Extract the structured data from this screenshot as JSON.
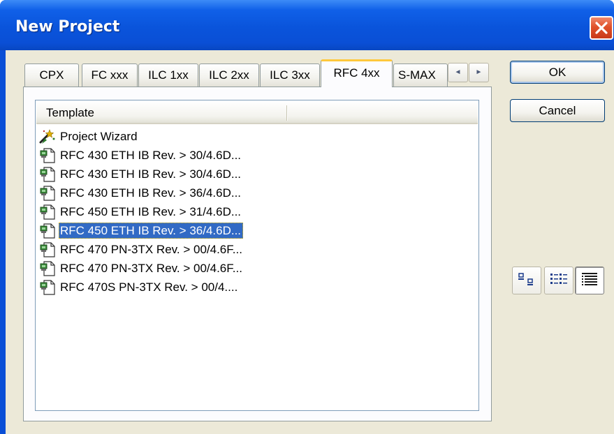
{
  "window": {
    "title": "New Project"
  },
  "tabs": [
    {
      "label": "CPX",
      "active": false
    },
    {
      "label": "FC xxx",
      "active": false
    },
    {
      "label": "ILC 1xx",
      "active": false
    },
    {
      "label": "ILC 2xx",
      "active": false
    },
    {
      "label": "ILC 3xx",
      "active": false
    },
    {
      "label": "RFC 4xx",
      "active": true
    },
    {
      "label": "S-MAX",
      "active": false
    }
  ],
  "tab_scroll": {
    "left": "◄",
    "right": "►"
  },
  "list": {
    "column_header": "Template",
    "items": [
      {
        "label": "Project Wizard",
        "icon": "wizard-icon",
        "selected": false
      },
      {
        "label": "RFC 430 ETH IB Rev. > 30/4.6D...",
        "icon": "template-file-icon",
        "selected": false
      },
      {
        "label": "RFC 430 ETH IB Rev. > 30/4.6D...",
        "icon": "template-file-icon",
        "selected": false
      },
      {
        "label": "RFC 430 ETH IB Rev. > 36/4.6D...",
        "icon": "template-file-icon",
        "selected": false
      },
      {
        "label": "RFC 450 ETH IB Rev. > 31/4.6D...",
        "icon": "template-file-icon",
        "selected": false
      },
      {
        "label": "RFC 450 ETH IB Rev. > 36/4.6D...",
        "icon": "template-file-icon",
        "selected": true
      },
      {
        "label": "RFC 470 PN-3TX Rev. > 00/4.6F...",
        "icon": "template-file-icon",
        "selected": false
      },
      {
        "label": "RFC 470 PN-3TX Rev. > 00/4.6F...",
        "icon": "template-file-icon",
        "selected": false
      },
      {
        "label": "RFC 470S PN-3TX Rev. > 00/4....",
        "icon": "template-file-icon",
        "selected": false
      }
    ]
  },
  "buttons": {
    "ok": "OK",
    "cancel": "Cancel"
  },
  "view_buttons": [
    {
      "name": "large-icons",
      "icon": "large-icons-view-icon",
      "pressed": false
    },
    {
      "name": "list",
      "icon": "list-view-icon",
      "pressed": false
    },
    {
      "name": "details",
      "icon": "details-view-icon",
      "pressed": true
    }
  ],
  "colors": {
    "titlebar": "#0a4fd6",
    "selection": "#316ac5",
    "dialog_face": "#ece9d8",
    "active_tab_accent": "#ffc83c",
    "close_button": "#e0522a"
  }
}
